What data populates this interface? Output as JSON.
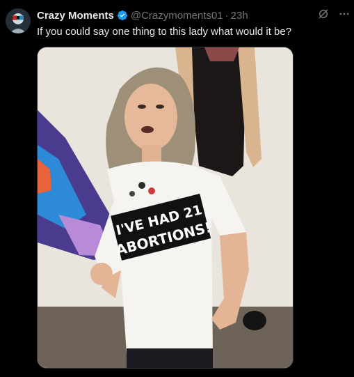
{
  "post": {
    "author_name": "Crazy Moments",
    "author_handle": "@Crazymoments01",
    "separator": "·",
    "time": "23h",
    "text": "If you could say one thing to this lady what would it be?"
  },
  "media": {
    "shirt_line1": "I'VE HAD 21",
    "shirt_line2": "ABORTIONS!"
  },
  "icons": {
    "verified": "verified-badge-icon",
    "grok": "grok-icon",
    "more": "more-icon"
  },
  "colors": {
    "background": "#000000",
    "text_primary": "#e7e9ea",
    "text_secondary": "#71767b",
    "verified_blue": "#1d9bf0"
  }
}
